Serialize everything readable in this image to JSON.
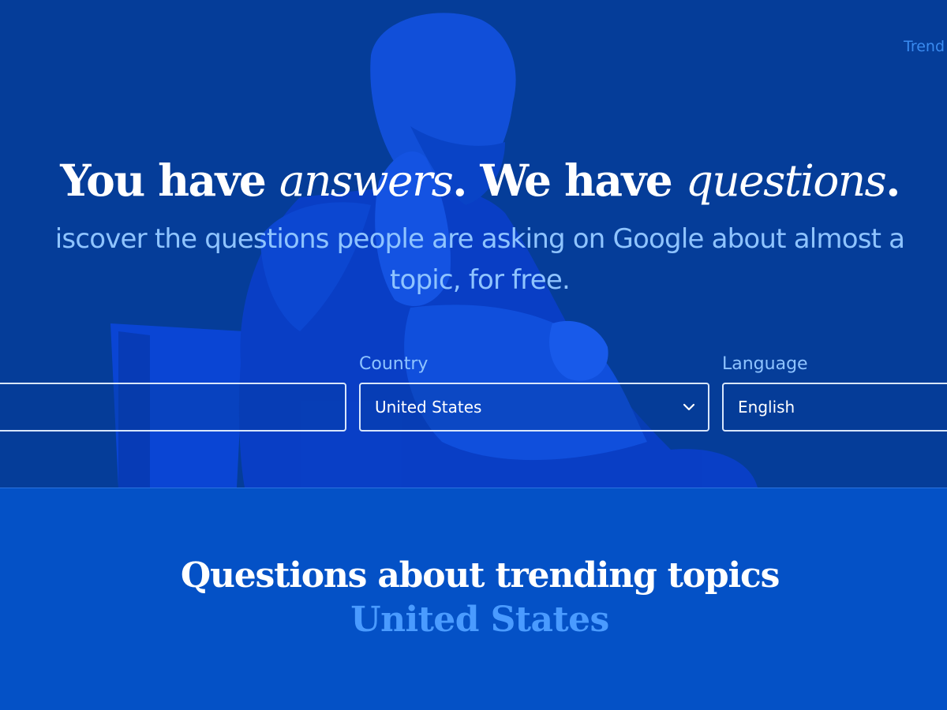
{
  "nav": {
    "trending_link": "Trend"
  },
  "hero": {
    "headline_parts": [
      "You have ",
      "answers",
      ". We have ",
      "questions",
      "."
    ],
    "subline_line1": "iscover the questions people are asking on Google about almost a",
    "subline_line2": "topic, for free."
  },
  "search": {
    "topic_value": ""
  },
  "country": {
    "label": "Country",
    "selected": "United States",
    "icon": "chevron-down-icon"
  },
  "language": {
    "label": "Language",
    "selected": "English"
  },
  "trending": {
    "title": "Questions about trending topics",
    "country": "United States"
  },
  "colors": {
    "hero_bg": "#053d99",
    "section_bg": "#0451c6",
    "accent_light": "#8fc4ff",
    "accent_link": "#3a8bf0",
    "country_highlight": "#4a9bff"
  }
}
